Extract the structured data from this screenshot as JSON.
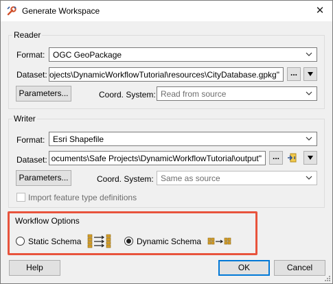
{
  "window": {
    "title": "Generate Workspace",
    "app_icon": "fme-wrench-icon",
    "close_glyph": "✕"
  },
  "reader": {
    "group_label": "Reader",
    "format_label": "Format:",
    "format_value": "OGC GeoPackage",
    "dataset_label": "Dataset:",
    "dataset_value": "ojects\\DynamicWorkflowTutorial\\resources\\CityDatabase.gpkg\"",
    "browse_label": "...",
    "parameters_label": "Parameters...",
    "coord_label": "Coord. System:",
    "coord_value": "Read from source"
  },
  "writer": {
    "group_label": "Writer",
    "format_label": "Format:",
    "format_value": "Esri Shapefile",
    "dataset_label": "Dataset:",
    "dataset_value": "ocuments\\Safe Projects\\DynamicWorkflowTutorial\\output\"",
    "browse_label": "...",
    "parameters_label": "Parameters...",
    "coord_label": "Coord. System:",
    "coord_value": "Same as source",
    "import_label": "Import feature type definitions",
    "import_checked": false
  },
  "workflow": {
    "group_label": "Workflow Options",
    "static_label": "Static Schema",
    "dynamic_label": "Dynamic Schema",
    "selected": "dynamic"
  },
  "buttons": {
    "help": "Help",
    "ok": "OK",
    "cancel": "Cancel"
  },
  "colors": {
    "highlight": "#e8533c",
    "accent": "#0078d7"
  }
}
